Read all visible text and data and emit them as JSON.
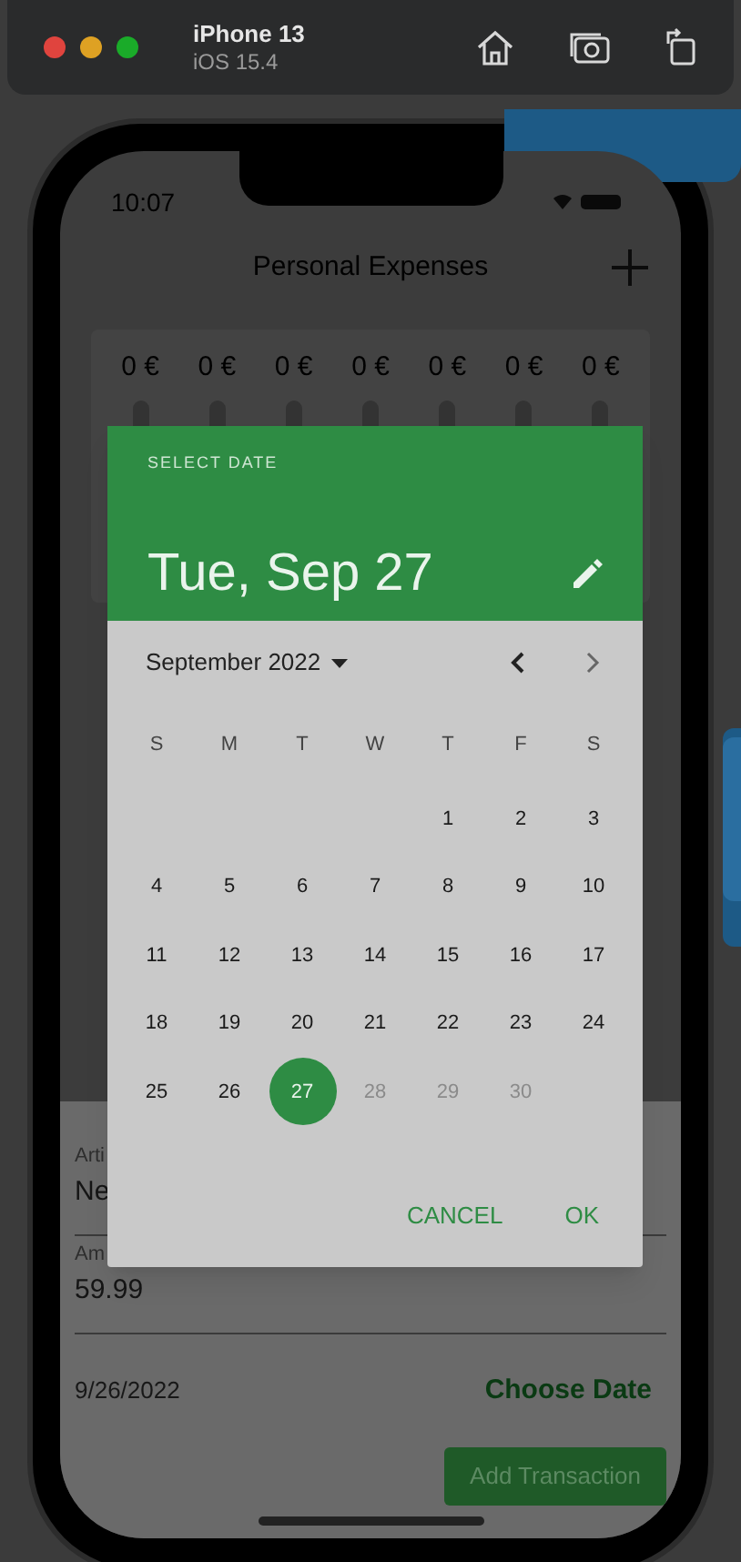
{
  "simulator": {
    "device": "iPhone 13",
    "os": "iOS 15.4"
  },
  "status_bar": {
    "time": "10:07"
  },
  "app_bar": {
    "title": "Personal Expenses"
  },
  "chart": {
    "bars": [
      {
        "label": "0 €",
        "level": 0
      },
      {
        "label": "0 €",
        "level": 0
      },
      {
        "label": "0 €",
        "level": 0
      },
      {
        "label": "0 €",
        "level": 0
      },
      {
        "label": "0 €",
        "level": 0
      },
      {
        "label": "0 €",
        "level": 0
      },
      {
        "label": "0 €",
        "level": 0
      }
    ]
  },
  "form": {
    "fields": [
      {
        "label": "Arti",
        "value": "Ne"
      },
      {
        "label": "Am",
        "value": "59.99"
      }
    ],
    "date": "9/26/2022",
    "choose_date": "Choose Date",
    "submit": "Add Transaction"
  },
  "date_dialog": {
    "header_label": "SELECT DATE",
    "header_date": "Tue, Sep 27",
    "month": "September 2022",
    "weekdays": [
      "S",
      "M",
      "T",
      "W",
      "T",
      "F",
      "S"
    ],
    "weeks": [
      [
        {
          "kind": "blank"
        },
        {
          "kind": "blank"
        },
        {
          "kind": "blank"
        },
        {
          "kind": "blank"
        },
        {
          "kind": "day",
          "label": "1",
          "selected": false,
          "disabled": false
        },
        {
          "kind": "day",
          "label": "2",
          "selected": false,
          "disabled": false
        },
        {
          "kind": "day",
          "label": "3",
          "selected": false,
          "disabled": false
        }
      ],
      [
        {
          "kind": "day",
          "label": "4",
          "selected": false,
          "disabled": false
        },
        {
          "kind": "day",
          "label": "5",
          "selected": false,
          "disabled": false
        },
        {
          "kind": "day",
          "label": "6",
          "selected": false,
          "disabled": false
        },
        {
          "kind": "day",
          "label": "7",
          "selected": false,
          "disabled": false
        },
        {
          "kind": "day",
          "label": "8",
          "selected": false,
          "disabled": false
        },
        {
          "kind": "day",
          "label": "9",
          "selected": false,
          "disabled": false
        },
        {
          "kind": "day",
          "label": "10",
          "selected": false,
          "disabled": false
        }
      ],
      [
        {
          "kind": "day",
          "label": "11",
          "selected": false,
          "disabled": false
        },
        {
          "kind": "day",
          "label": "12",
          "selected": false,
          "disabled": false
        },
        {
          "kind": "day",
          "label": "13",
          "selected": false,
          "disabled": false
        },
        {
          "kind": "day",
          "label": "14",
          "selected": false,
          "disabled": false
        },
        {
          "kind": "day",
          "label": "15",
          "selected": false,
          "disabled": false
        },
        {
          "kind": "day",
          "label": "16",
          "selected": false,
          "disabled": false
        },
        {
          "kind": "day",
          "label": "17",
          "selected": false,
          "disabled": false
        }
      ],
      [
        {
          "kind": "day",
          "label": "18",
          "selected": false,
          "disabled": false
        },
        {
          "kind": "day",
          "label": "19",
          "selected": false,
          "disabled": false
        },
        {
          "kind": "day",
          "label": "20",
          "selected": false,
          "disabled": false
        },
        {
          "kind": "day",
          "label": "21",
          "selected": false,
          "disabled": false
        },
        {
          "kind": "day",
          "label": "22",
          "selected": false,
          "disabled": false
        },
        {
          "kind": "day",
          "label": "23",
          "selected": false,
          "disabled": false
        },
        {
          "kind": "day",
          "label": "24",
          "selected": false,
          "disabled": false
        }
      ],
      [
        {
          "kind": "day",
          "label": "25",
          "selected": false,
          "disabled": false
        },
        {
          "kind": "day",
          "label": "26",
          "selected": false,
          "disabled": false
        },
        {
          "kind": "day",
          "label": "27",
          "selected": true,
          "disabled": false
        },
        {
          "kind": "day",
          "label": "28",
          "selected": false,
          "disabled": true
        },
        {
          "kind": "day",
          "label": "29",
          "selected": false,
          "disabled": true
        },
        {
          "kind": "day",
          "label": "30",
          "selected": false,
          "disabled": true
        },
        {
          "kind": "blank"
        }
      ]
    ],
    "buttons": [
      "CANCEL",
      "OK"
    ]
  }
}
